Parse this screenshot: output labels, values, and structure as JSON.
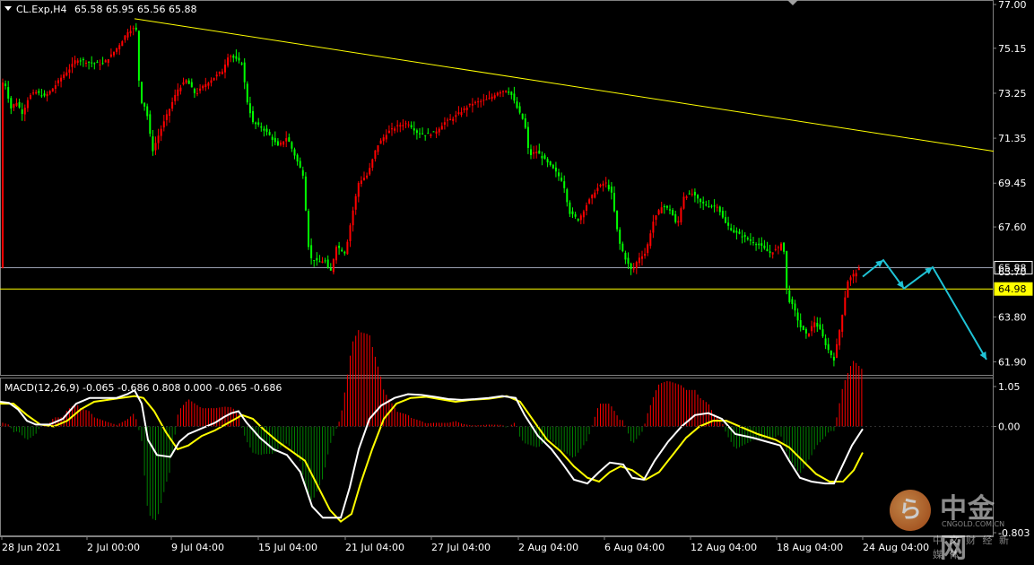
{
  "header": {
    "symbol": "CL.Exp,H4",
    "ohlc": "65.58 65.95 65.56 65.88"
  },
  "macd": {
    "label": "MACD(12,26,9) -0.065 -0.686 0.808 0.000 -0.065 -0.686",
    "ticks": [
      "1.05",
      "0.00",
      "-0.803"
    ],
    "tick_values": [
      1.05,
      0.0,
      -0.803
    ],
    "ylim": [
      -0.803,
      1.05
    ]
  },
  "price_axis": {
    "ticks": [
      "77.00",
      "75.15",
      "73.25",
      "71.35",
      "69.45",
      "67.60",
      "65.70",
      "63.80",
      "61.90"
    ],
    "tick_values": [
      77.0,
      75.15,
      73.25,
      71.35,
      69.45,
      67.6,
      65.7,
      63.8,
      61.9
    ],
    "ylim": [
      61.35,
      77.0
    ],
    "current_price": {
      "text": "65.88",
      "value": 65.88,
      "color": "#ffffff"
    },
    "marked_level": {
      "text": "64.98",
      "value": 64.98,
      "color": "#ffff00"
    }
  },
  "time_axis": {
    "labels": [
      "28 Jun 2021",
      "2 Jul 00:00",
      "9 Jul 04:00",
      "15 Jul 04:00",
      "21 Jul 04:00",
      "27 Jul 04:00",
      "2 Aug 04:00",
      "6 Aug 04:00",
      "12 Aug 04:00",
      "18 Aug 04:00",
      "24 Aug 04:00"
    ]
  },
  "colors": {
    "bull": "#ff0000",
    "bear": "#00ff00",
    "hist_pos": "#ff0000",
    "hist_neg": "#008000",
    "macd_line": "#ffffff",
    "signal_line": "#ffff00",
    "trendline": "#ffff00",
    "projection": "#1fc3d6",
    "grid": "#808080"
  },
  "watermark": {
    "brand": "中金网",
    "domain": "CNGOLD.COM.CN",
    "tagline": "中 文 财 经 新 媒 体"
  },
  "chart_data": {
    "type": "candlestick",
    "series_price_path": [
      [
        0,
        73.8
      ],
      [
        6,
        73.6
      ],
      [
        12,
        72.6
      ],
      [
        18,
        72.9
      ],
      [
        25,
        72.4
      ],
      [
        32,
        73.1
      ],
      [
        40,
        73.3
      ],
      [
        50,
        73.1
      ],
      [
        60,
        73.5
      ],
      [
        70,
        74.0
      ],
      [
        78,
        74.3
      ],
      [
        85,
        74.7
      ],
      [
        95,
        74.6
      ],
      [
        105,
        74.5
      ],
      [
        115,
        74.5
      ],
      [
        125,
        74.9
      ],
      [
        135,
        75.4
      ],
      [
        143,
        75.9
      ],
      [
        150,
        76.0
      ],
      [
        152,
        75.9
      ],
      [
        156,
        73.0
      ],
      [
        163,
        72.6
      ],
      [
        170,
        70.8
      ],
      [
        178,
        71.6
      ],
      [
        188,
        72.5
      ],
      [
        198,
        73.4
      ],
      [
        208,
        73.8
      ],
      [
        218,
        73.2
      ],
      [
        228,
        73.6
      ],
      [
        238,
        73.9
      ],
      [
        248,
        74.2
      ],
      [
        255,
        74.9
      ],
      [
        262,
        74.7
      ],
      [
        270,
        74.5
      ],
      [
        275,
        73.0
      ],
      [
        282,
        72.0
      ],
      [
        292,
        71.8
      ],
      [
        300,
        71.5
      ],
      [
        310,
        71.0
      ],
      [
        320,
        71.4
      ],
      [
        330,
        70.5
      ],
      [
        338,
        69.8
      ],
      [
        345,
        66.3
      ],
      [
        355,
        66.1
      ],
      [
        362,
        66.2
      ],
      [
        368,
        65.6
      ],
      [
        375,
        66.8
      ],
      [
        385,
        66.5
      ],
      [
        392,
        68.0
      ],
      [
        400,
        69.5
      ],
      [
        410,
        69.8
      ],
      [
        420,
        71.0
      ],
      [
        432,
        71.6
      ],
      [
        445,
        71.9
      ],
      [
        455,
        72.0
      ],
      [
        465,
        71.6
      ],
      [
        475,
        71.5
      ],
      [
        485,
        71.6
      ],
      [
        495,
        72.0
      ],
      [
        505,
        72.2
      ],
      [
        515,
        72.5
      ],
      [
        525,
        72.8
      ],
      [
        535,
        72.9
      ],
      [
        545,
        73.0
      ],
      [
        555,
        73.3
      ],
      [
        565,
        73.4
      ],
      [
        570,
        73.2
      ],
      [
        578,
        72.5
      ],
      [
        585,
        72.0
      ],
      [
        590,
        70.6
      ],
      [
        598,
        70.8
      ],
      [
        608,
        70.4
      ],
      [
        618,
        70.0
      ],
      [
        628,
        69.5
      ],
      [
        635,
        68.2
      ],
      [
        645,
        67.9
      ],
      [
        655,
        68.6
      ],
      [
        665,
        69.2
      ],
      [
        675,
        69.5
      ],
      [
        682,
        69.0
      ],
      [
        690,
        67.0
      ],
      [
        698,
        66.2
      ],
      [
        705,
        65.7
      ],
      [
        712,
        66.3
      ],
      [
        720,
        66.5
      ],
      [
        728,
        67.8
      ],
      [
        738,
        68.5
      ],
      [
        748,
        68.3
      ],
      [
        755,
        67.6
      ],
      [
        762,
        68.9
      ],
      [
        772,
        69.0
      ],
      [
        782,
        68.6
      ],
      [
        792,
        68.5
      ],
      [
        800,
        68.5
      ],
      [
        808,
        67.8
      ],
      [
        818,
        67.4
      ],
      [
        828,
        67.2
      ],
      [
        838,
        67.0
      ],
      [
        848,
        66.8
      ],
      [
        858,
        66.5
      ],
      [
        868,
        66.7
      ],
      [
        873,
        67.1
      ],
      [
        878,
        64.6
      ],
      [
        885,
        64.2
      ],
      [
        892,
        63.4
      ],
      [
        900,
        63.0
      ],
      [
        908,
        63.6
      ],
      [
        915,
        63.2
      ],
      [
        922,
        62.5
      ],
      [
        930,
        62.0
      ],
      [
        935,
        63.0
      ],
      [
        940,
        64.1
      ],
      [
        945,
        65.3
      ],
      [
        952,
        65.6
      ],
      [
        960,
        65.88
      ]
    ],
    "x_unit": "time-index",
    "trendline": {
      "from": [
        150,
        76.4
      ],
      "to": [
        1108,
        70.8
      ]
    },
    "projection_path": [
      [
        962,
        65.5
      ],
      [
        985,
        66.2
      ],
      [
        1008,
        65.0
      ],
      [
        1040,
        65.9
      ],
      [
        1100,
        62.0
      ]
    ],
    "macd_line": [
      [
        0,
        0.65
      ],
      [
        10,
        0.62
      ],
      [
        20,
        0.45
      ],
      [
        30,
        0.15
      ],
      [
        40,
        0.05
      ],
      [
        55,
        0.05
      ],
      [
        70,
        0.2
      ],
      [
        85,
        0.6
      ],
      [
        100,
        0.75
      ],
      [
        115,
        0.75
      ],
      [
        130,
        0.75
      ],
      [
        142,
        0.85
      ],
      [
        150,
        0.95
      ],
      [
        158,
        0.6
      ],
      [
        165,
        -0.35
      ],
      [
        175,
        -0.75
      ],
      [
        190,
        -0.8
      ],
      [
        200,
        -0.4
      ],
      [
        210,
        -0.2
      ],
      [
        225,
        -0.05
      ],
      [
        240,
        0.1
      ],
      [
        250,
        0.25
      ],
      [
        258,
        0.35
      ],
      [
        266,
        0.4
      ],
      [
        275,
        0.1
      ],
      [
        290,
        -0.3
      ],
      [
        305,
        -0.6
      ],
      [
        320,
        -0.75
      ],
      [
        335,
        -1.2
      ],
      [
        348,
        -2.1
      ],
      [
        360,
        -2.4
      ],
      [
        370,
        -2.4
      ],
      [
        380,
        -2.4
      ],
      [
        390,
        -1.6
      ],
      [
        400,
        -0.6
      ],
      [
        412,
        0.2
      ],
      [
        425,
        0.55
      ],
      [
        440,
        0.75
      ],
      [
        455,
        0.85
      ],
      [
        470,
        0.83
      ],
      [
        485,
        0.78
      ],
      [
        500,
        0.72
      ],
      [
        515,
        0.7
      ],
      [
        530,
        0.72
      ],
      [
        545,
        0.75
      ],
      [
        560,
        0.8
      ],
      [
        575,
        0.75
      ],
      [
        585,
        0.3
      ],
      [
        600,
        -0.25
      ],
      [
        615,
        -0.6
      ],
      [
        628,
        -1.0
      ],
      [
        640,
        -1.4
      ],
      [
        655,
        -1.5
      ],
      [
        668,
        -1.2
      ],
      [
        680,
        -0.95
      ],
      [
        695,
        -1.0
      ],
      [
        705,
        -1.35
      ],
      [
        718,
        -1.4
      ],
      [
        730,
        -0.9
      ],
      [
        745,
        -0.4
      ],
      [
        760,
        0.0
      ],
      [
        775,
        0.3
      ],
      [
        790,
        0.35
      ],
      [
        805,
        0.2
      ],
      [
        820,
        -0.2
      ],
      [
        840,
        -0.3
      ],
      [
        855,
        -0.4
      ],
      [
        870,
        -0.5
      ],
      [
        880,
        -0.9
      ],
      [
        892,
        -1.35
      ],
      [
        905,
        -1.45
      ],
      [
        920,
        -1.5
      ],
      [
        930,
        -1.5
      ],
      [
        940,
        -1.0
      ],
      [
        950,
        -0.5
      ],
      [
        962,
        -0.065
      ]
    ],
    "signal_line": [
      [
        0,
        0.6
      ],
      [
        15,
        0.6
      ],
      [
        30,
        0.3
      ],
      [
        45,
        0.05
      ],
      [
        60,
        0.0
      ],
      [
        75,
        0.15
      ],
      [
        90,
        0.45
      ],
      [
        105,
        0.65
      ],
      [
        120,
        0.7
      ],
      [
        135,
        0.75
      ],
      [
        150,
        0.8
      ],
      [
        160,
        0.75
      ],
      [
        172,
        0.4
      ],
      [
        185,
        -0.15
      ],
      [
        198,
        -0.6
      ],
      [
        210,
        -0.5
      ],
      [
        225,
        -0.25
      ],
      [
        240,
        -0.1
      ],
      [
        255,
        0.1
      ],
      [
        270,
        0.3
      ],
      [
        282,
        0.2
      ],
      [
        295,
        -0.1
      ],
      [
        310,
        -0.4
      ],
      [
        325,
        -0.65
      ],
      [
        340,
        -0.9
      ],
      [
        355,
        -1.6
      ],
      [
        368,
        -2.2
      ],
      [
        380,
        -2.5
      ],
      [
        392,
        -2.3
      ],
      [
        402,
        -1.5
      ],
      [
        415,
        -0.6
      ],
      [
        428,
        0.2
      ],
      [
        442,
        0.6
      ],
      [
        458,
        0.75
      ],
      [
        475,
        0.78
      ],
      [
        490,
        0.72
      ],
      [
        508,
        0.65
      ],
      [
        525,
        0.7
      ],
      [
        545,
        0.73
      ],
      [
        565,
        0.8
      ],
      [
        580,
        0.65
      ],
      [
        595,
        0.15
      ],
      [
        610,
        -0.35
      ],
      [
        625,
        -0.65
      ],
      [
        640,
        -1.05
      ],
      [
        655,
        -1.35
      ],
      [
        668,
        -1.45
      ],
      [
        680,
        -1.2
      ],
      [
        692,
        -1.05
      ],
      [
        705,
        -1.15
      ],
      [
        720,
        -1.4
      ],
      [
        735,
        -1.2
      ],
      [
        750,
        -0.75
      ],
      [
        765,
        -0.3
      ],
      [
        780,
        0.0
      ],
      [
        795,
        0.15
      ],
      [
        810,
        0.15
      ],
      [
        825,
        0.0
      ],
      [
        845,
        -0.2
      ],
      [
        865,
        -0.35
      ],
      [
        880,
        -0.55
      ],
      [
        895,
        -0.9
      ],
      [
        910,
        -1.25
      ],
      [
        925,
        -1.45
      ],
      [
        940,
        -1.45
      ],
      [
        952,
        -1.15
      ],
      [
        962,
        -0.686
      ]
    ]
  }
}
